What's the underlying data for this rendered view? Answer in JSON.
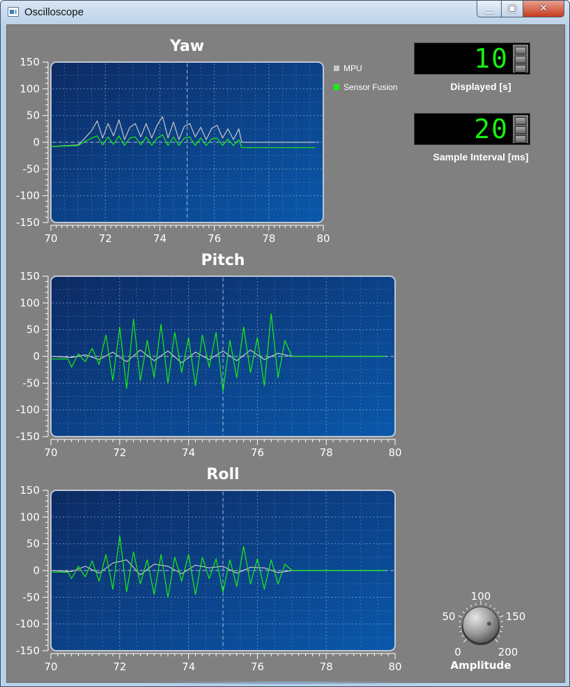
{
  "window": {
    "title": "Oscilloscope",
    "min_glyph": "▁",
    "max_glyph": "▣",
    "close_glyph": "✕"
  },
  "legend": {
    "items": [
      {
        "label": "MPU",
        "color": "#c8c8c8"
      },
      {
        "label": "Sensor Fusion",
        "color": "#19f012"
      }
    ]
  },
  "controls": {
    "displayed": {
      "value": "10",
      "label": "Displayed [s]"
    },
    "sample_interval": {
      "value": "20",
      "label": "Sample Interval [ms]"
    },
    "amplitude": {
      "label": "Amplitude",
      "scale": [
        "0",
        "50",
        "100",
        "150",
        "200"
      ],
      "value": 100
    }
  },
  "colors": {
    "plot_dark": "#0d2a63",
    "plot_light": "#0a58ab",
    "mpu": "#c8c8c8",
    "fusion": "#19f012",
    "panel": "#808080"
  },
  "chart_data": [
    {
      "type": "line",
      "title": "Yaw",
      "xlim": [
        70,
        80
      ],
      "ylim": [
        -150,
        150
      ],
      "xticks": [
        "70",
        "72",
        "74",
        "76",
        "78",
        "80"
      ],
      "yticks": [
        "150",
        "100",
        "50",
        "0",
        "-50",
        "-100",
        "-150"
      ],
      "grid": true,
      "legend_position": "right",
      "x_end": 79.7,
      "series": [
        {
          "name": "MPU",
          "color": "#c8c8c8",
          "x": [
            70.0,
            71.0,
            71.2,
            71.5,
            71.7,
            71.9,
            72.1,
            72.3,
            72.5,
            72.7,
            72.9,
            73.1,
            73.3,
            73.5,
            73.7,
            73.9,
            74.1,
            74.3,
            74.5,
            74.7,
            74.9,
            75.1,
            75.3,
            75.5,
            75.7,
            75.9,
            76.1,
            76.3,
            76.5,
            76.7,
            76.9,
            77.0,
            79.7
          ],
          "y": [
            -8,
            -5,
            5,
            22,
            40,
            8,
            35,
            12,
            42,
            5,
            28,
            35,
            10,
            35,
            8,
            32,
            48,
            8,
            38,
            5,
            30,
            35,
            10,
            28,
            5,
            26,
            32,
            8,
            25,
            5,
            25,
            0,
            0
          ]
        },
        {
          "name": "Sensor Fusion",
          "color": "#19f012",
          "x": [
            70.0,
            71.0,
            71.2,
            71.5,
            71.7,
            71.9,
            72.1,
            72.3,
            72.5,
            72.7,
            72.9,
            73.1,
            73.3,
            73.5,
            73.7,
            73.9,
            74.1,
            74.3,
            74.5,
            74.7,
            74.9,
            75.1,
            75.3,
            75.5,
            75.7,
            75.9,
            76.1,
            76.3,
            76.5,
            76.7,
            76.9,
            77.0,
            79.7
          ],
          "y": [
            -8,
            -6,
            0,
            8,
            12,
            -5,
            10,
            -4,
            12,
            -6,
            8,
            10,
            -5,
            10,
            -6,
            8,
            14,
            -6,
            10,
            -6,
            8,
            10,
            -6,
            8,
            -6,
            6,
            8,
            -6,
            6,
            -6,
            5,
            -10,
            -10
          ]
        }
      ]
    },
    {
      "type": "line",
      "title": "Pitch",
      "xlim": [
        70,
        80
      ],
      "ylim": [
        -150,
        150
      ],
      "xticks": [
        "70",
        "72",
        "74",
        "76",
        "78",
        "80"
      ],
      "yticks": [
        "150",
        "100",
        "50",
        "0",
        "-50",
        "-100",
        "-150"
      ],
      "grid": true,
      "x_end": 79.7,
      "series": [
        {
          "name": "MPU",
          "color": "#c8c8c8",
          "x": [
            70.0,
            70.6,
            71.0,
            71.4,
            71.8,
            72.2,
            72.6,
            73.0,
            73.4,
            73.8,
            74.2,
            74.6,
            75.0,
            75.4,
            75.8,
            76.2,
            76.6,
            77.0,
            79.7
          ],
          "y": [
            0,
            -2,
            3,
            -6,
            8,
            -10,
            12,
            -8,
            10,
            -12,
            8,
            -6,
            10,
            -8,
            12,
            -6,
            6,
            0,
            0
          ]
        },
        {
          "name": "Sensor Fusion",
          "color": "#19f012",
          "x": [
            70.0,
            70.5,
            70.6,
            70.8,
            71.0,
            71.2,
            71.4,
            71.6,
            71.8,
            72.0,
            72.2,
            72.4,
            72.6,
            72.8,
            73.0,
            73.2,
            73.4,
            73.6,
            73.8,
            74.0,
            74.2,
            74.4,
            74.6,
            74.8,
            75.0,
            75.2,
            75.4,
            75.6,
            75.8,
            76.0,
            76.2,
            76.4,
            76.6,
            76.8,
            77.0,
            79.7
          ],
          "y": [
            -5,
            -5,
            -20,
            5,
            -10,
            15,
            -15,
            40,
            -45,
            55,
            -60,
            70,
            -45,
            30,
            -40,
            60,
            -50,
            45,
            -30,
            35,
            -55,
            40,
            -20,
            45,
            -65,
            30,
            -40,
            55,
            -30,
            35,
            -55,
            80,
            -40,
            30,
            0,
            0
          ]
        }
      ]
    },
    {
      "type": "line",
      "title": "Roll",
      "xlim": [
        70,
        80
      ],
      "ylim": [
        -150,
        150
      ],
      "xticks": [
        "70",
        "72",
        "74",
        "76",
        "78",
        "80"
      ],
      "yticks": [
        "150",
        "100",
        "50",
        "0",
        "-50",
        "-100",
        "-150"
      ],
      "grid": true,
      "x_end": 79.7,
      "series": [
        {
          "name": "MPU",
          "color": "#c8c8c8",
          "x": [
            70.0,
            70.6,
            71.0,
            71.4,
            71.8,
            72.2,
            72.6,
            73.0,
            73.4,
            73.8,
            74.2,
            74.6,
            75.0,
            75.4,
            75.8,
            76.2,
            76.6,
            77.0,
            79.7
          ],
          "y": [
            0,
            -2,
            8,
            -5,
            14,
            20,
            -8,
            12,
            8,
            -6,
            10,
            5,
            8,
            -5,
            6,
            5,
            -4,
            0,
            0
          ]
        },
        {
          "name": "Sensor Fusion",
          "color": "#19f012",
          "x": [
            70.0,
            70.5,
            70.6,
            70.8,
            71.0,
            71.2,
            71.4,
            71.6,
            71.8,
            72.0,
            72.2,
            72.4,
            72.6,
            72.8,
            73.0,
            73.2,
            73.4,
            73.6,
            73.8,
            74.0,
            74.2,
            74.4,
            74.6,
            74.8,
            75.0,
            75.2,
            75.4,
            75.6,
            75.8,
            76.0,
            76.2,
            76.4,
            76.6,
            76.8,
            77.0,
            79.7
          ],
          "y": [
            -3,
            -3,
            -15,
            8,
            -12,
            18,
            -20,
            30,
            -35,
            65,
            -40,
            35,
            -25,
            20,
            -45,
            30,
            -50,
            25,
            -20,
            30,
            -45,
            25,
            -15,
            22,
            -40,
            20,
            -30,
            45,
            -25,
            22,
            -35,
            20,
            -25,
            12,
            0,
            0
          ]
        }
      ]
    }
  ]
}
